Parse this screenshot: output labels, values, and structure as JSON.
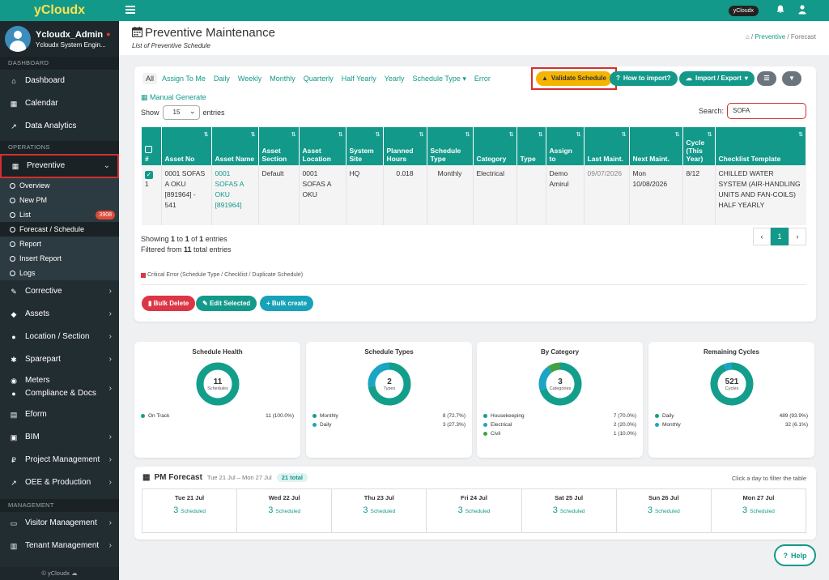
{
  "brand": {
    "logo": "yCloudx",
    "footer": "© yCloudx"
  },
  "user": {
    "name": "Ycloudx_Admin",
    "role": "Ycloudx System Engin..."
  },
  "topbar": {
    "pill": "yCloudx"
  },
  "sidebar": {
    "sections": {
      "dashboard": "DASHBOARD",
      "operations": "OPERATIONS",
      "management": "MANAGEMENT"
    },
    "dashboard_items": [
      "Dashboard",
      "Calendar",
      "Data Analytics"
    ],
    "preventive": "Preventive",
    "sub_items": [
      "Overview",
      "New PM",
      "List",
      "Forecast / Schedule",
      "Report",
      "Insert Report",
      "Logs"
    ],
    "list_badge": "3908",
    "ops_items": [
      "Corrective",
      "Assets",
      "Location / Section",
      "Sparepart",
      "Meters",
      "Compliance & Docs",
      "Eform",
      "BIM",
      "Project Management",
      "OEE & Production"
    ],
    "mgmt_items": [
      "Visitor Management",
      "Tenant Management"
    ]
  },
  "page": {
    "title": "Preventive Maintenance",
    "subtitle": "List of Preventive Schedule"
  },
  "breadcrumb": {
    "current_parent": "Preventive",
    "current": "Forecast",
    "sep": "/"
  },
  "tabs": [
    "All",
    "Assign To Me",
    "Daily",
    "Weekly",
    "Monthly",
    "Quarterly",
    "Half Yearly",
    "Yearly",
    "Schedule Type",
    "Error"
  ],
  "buttons": {
    "validate": "Validate Schedule",
    "how_import": "How to import?",
    "import_export": "Import / Export",
    "manual_generate": "Manual Generate",
    "bulk_delete": "Bulk Delete",
    "edit_selected": "Edit Selected",
    "bulk_create": "Bulk create"
  },
  "table_controls": {
    "show": "Show",
    "entries_value": "15",
    "entries": "entries",
    "search_label": "Search:",
    "search_value": "SOFA"
  },
  "table": {
    "headers": [
      "#",
      "Asset No",
      "Asset Name",
      "Asset Section",
      "Asset Location",
      "System Site",
      "Planned Hours",
      "Schedule Type",
      "Category",
      "Type",
      "Assign to",
      "Last Maint.",
      "Next Maint.",
      "Cycle (This Year)",
      "Checklist Template"
    ],
    "rows": [
      {
        "num": "1",
        "asset_no": "0001 SOFAS A OKU [891964] - 541",
        "asset_name": "0001 SOFAS A OKU [891964]",
        "section": "Default",
        "location": "0001 SOFAS A OKU",
        "site": "HQ",
        "hours": "0.018",
        "schedule": "Monthly",
        "category": "Electrical",
        "type": "",
        "assign": "Demo Amirul",
        "last": "09/07/2026",
        "next": "Mon 10/08/2026",
        "cycle": "8/12",
        "checklist": "CHILLED WATER SYSTEM (AIR-HANDLING UNITS AND FAN-COILS) HALF YEARLY"
      }
    ]
  },
  "showing": {
    "line1_a": "Showing ",
    "from": "1",
    "to_word": " to ",
    "to": "1",
    "of_word": " of ",
    "total": "1",
    "entries_word": " entries",
    "line2_a": "Filtered from ",
    "filtered": "11",
    "line2_b": " total entries"
  },
  "pager": {
    "prev": "‹",
    "page": "1",
    "next": "›"
  },
  "legend_error": "Critical Error (Schedule Type / Checklist / Duplicate Schedule)",
  "stats": [
    {
      "title": "Schedule Health",
      "center_value": "11",
      "center_label": "Schedules",
      "legend": [
        {
          "name": "On Track",
          "value": "11 (100.0%)",
          "color": "#139e8c"
        }
      ]
    },
    {
      "title": "Schedule Types",
      "center_value": "2",
      "center_label": "Types",
      "legend": [
        {
          "name": "Monthly",
          "value": "8 (72.7%)",
          "color": "#139e8c"
        },
        {
          "name": "Daily",
          "value": "3 (27.3%)",
          "color": "#1aa5c4"
        }
      ]
    },
    {
      "title": "By Category",
      "center_value": "3",
      "center_label": "Categories",
      "legend": [
        {
          "name": "Housekeeping",
          "value": "7 (70.0%)",
          "color": "#139e8c"
        },
        {
          "name": "Electrical",
          "value": "2 (20.0%)",
          "color": "#1aa5c4"
        },
        {
          "name": "Civil",
          "value": "1 (10.0%)",
          "color": "#43a047"
        }
      ]
    },
    {
      "title": "Remaining Cycles",
      "center_value": "521",
      "center_label": "Cycles",
      "legend": [
        {
          "name": "Daily",
          "value": "489 (93.9%)",
          "color": "#139e8c"
        },
        {
          "name": "Monthly",
          "value": "32 (6.1%)",
          "color": "#1aa5c4"
        }
      ]
    }
  ],
  "forecast": {
    "title": "PM Forecast",
    "range": "Tue 21 Jul – Mon 27 Jul",
    "badge": "21 total",
    "hint": "Click a day to filter the table",
    "scheduled_word": "Scheduled",
    "days": [
      {
        "label": "Tue 21 Jul",
        "count": "3"
      },
      {
        "label": "Wed 22 Jul",
        "count": "3"
      },
      {
        "label": "Thu 23 Jul",
        "count": "3"
      },
      {
        "label": "Fri 24 Jul",
        "count": "3"
      },
      {
        "label": "Sat 25 Jul",
        "count": "3"
      },
      {
        "label": "Sun 26 Jul",
        "count": "3"
      },
      {
        "label": "Mon 27 Jul",
        "count": "3"
      }
    ]
  },
  "help": "Help"
}
